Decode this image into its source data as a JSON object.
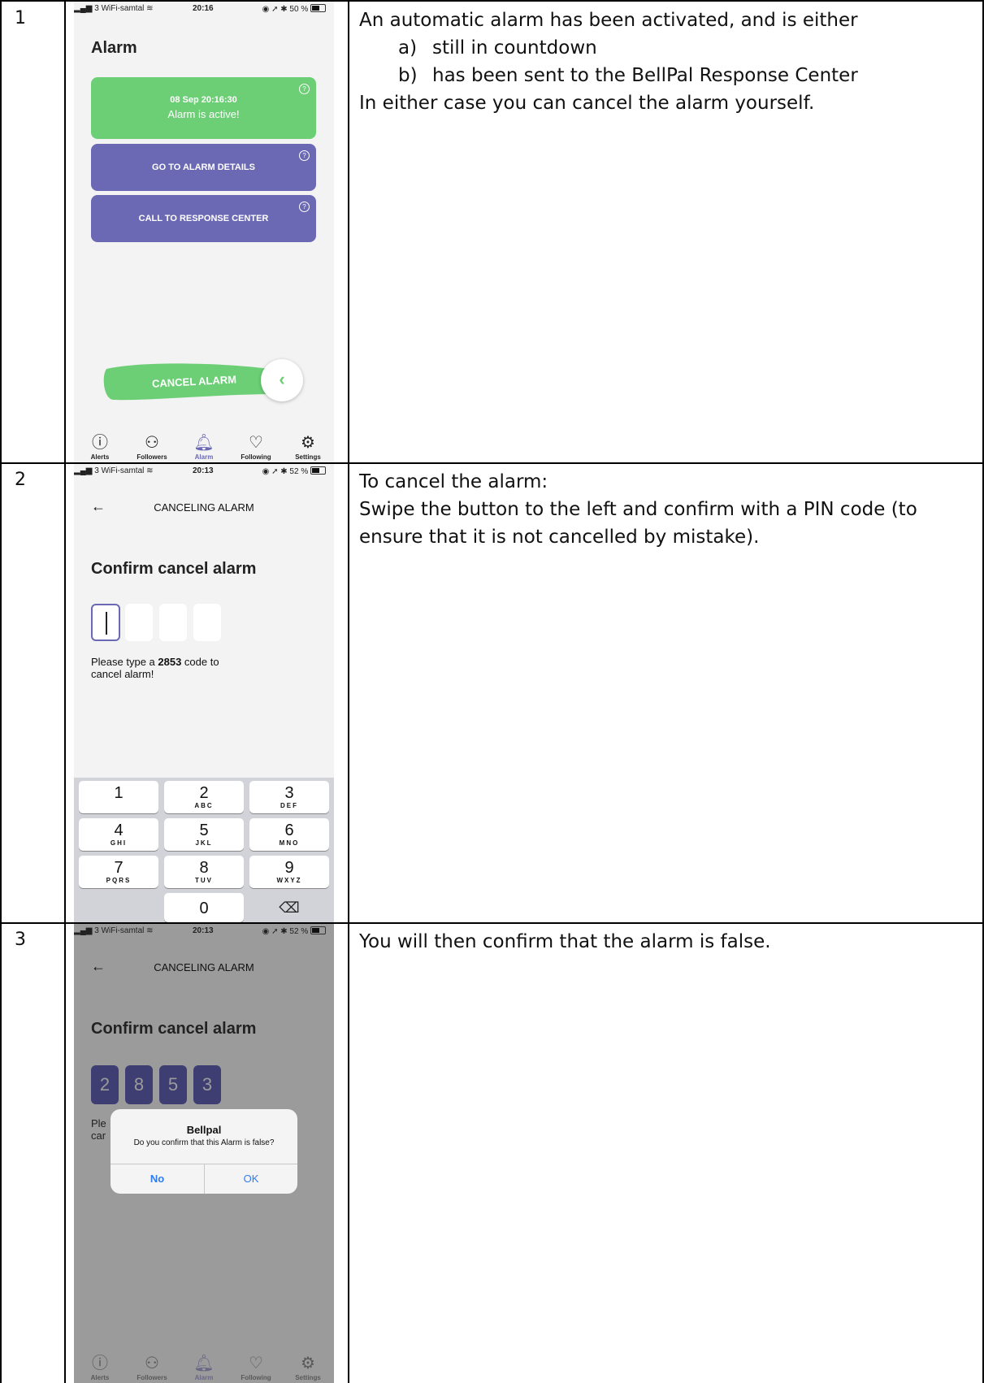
{
  "rows": [
    {
      "number": "1",
      "description": {
        "intro": "An automatic alarm has been activated, and is either",
        "items": [
          {
            "marker": "a)",
            "text": "still in countdown"
          },
          {
            "marker": "b)",
            "text": "has been sent to the BellPal Response Center"
          }
        ],
        "outro": "In either case you can cancel the alarm yourself."
      },
      "screen": {
        "status": {
          "carrier": "3 WiFi-samtal",
          "time": "20:16",
          "battery": "50 %",
          "battery_level": 0.5
        },
        "title": "Alarm",
        "alarm_card": {
          "date": "08 Sep 20:16:30",
          "status": "Alarm is active!"
        },
        "details_button": "GO TO ALARM DETAILS",
        "call_button": "CALL TO RESPONSE CENTER",
        "swipe_label": "CANCEL ALARM"
      }
    },
    {
      "number": "2",
      "description": {
        "line1": "To cancel the alarm:",
        "line2": "Swipe the button to the left and confirm with a PIN code (to ensure that it is not cancelled by mistake)."
      },
      "screen": {
        "status": {
          "carrier": "3 WiFi-samtal",
          "time": "20:13",
          "battery": "52 %",
          "battery_level": 0.52
        },
        "header": "CANCELING ALARM",
        "heading": "Confirm cancel alarm",
        "hint_prefix": "Please type a ",
        "hint_code": "2853",
        "hint_suffix": " code to",
        "hint_line2": "cancel alarm!",
        "keypad": [
          {
            "d": "1",
            "s": ""
          },
          {
            "d": "2",
            "s": "ABC"
          },
          {
            "d": "3",
            "s": "DEF"
          },
          {
            "d": "4",
            "s": "GHI"
          },
          {
            "d": "5",
            "s": "JKL"
          },
          {
            "d": "6",
            "s": "MNO"
          },
          {
            "d": "7",
            "s": "PQRS"
          },
          {
            "d": "8",
            "s": "TUV"
          },
          {
            "d": "9",
            "s": "WXYZ"
          },
          {
            "d": "0",
            "s": ""
          }
        ]
      }
    },
    {
      "number": "3",
      "description": {
        "text": "You will then confirm that the alarm is false."
      },
      "screen": {
        "status": {
          "carrier": "3 WiFi-samtal",
          "time": "20:13",
          "battery": "52 %",
          "battery_level": 0.52
        },
        "header": "CANCELING ALARM",
        "heading": "Confirm cancel alarm",
        "pin": [
          "2",
          "8",
          "5",
          "3"
        ],
        "hint_frag1": "Ple",
        "hint_frag2": "car",
        "dialog": {
          "title": "Bellpal",
          "message": "Do you confirm that this Alarm is false?",
          "no": "No",
          "ok": "OK"
        }
      }
    }
  ],
  "tabbar": [
    "Alerts",
    "Followers",
    "Alarm",
    "Following",
    "Settings"
  ],
  "colors": {
    "green": "#6ccf76",
    "purple": "#6b69b4",
    "link": "#2f7cf6",
    "overlay": "#9b9b9b"
  }
}
